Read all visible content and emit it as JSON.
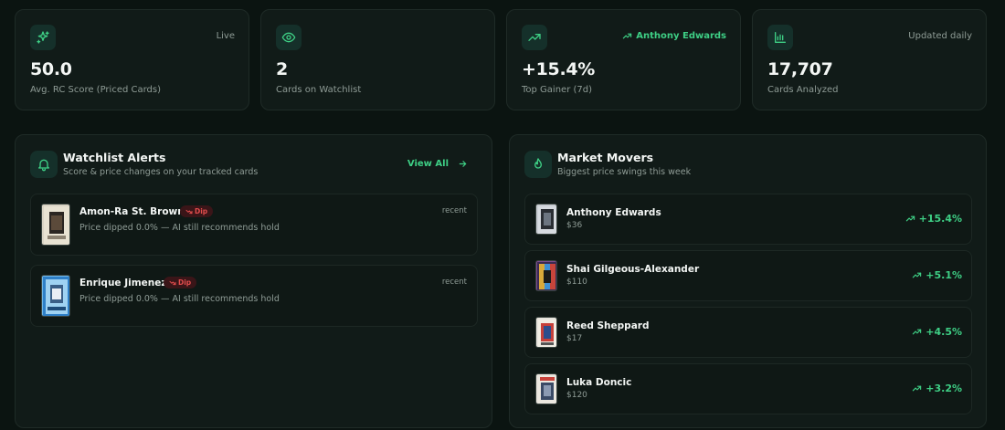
{
  "colors": {
    "accent": "#3ecf85",
    "danger": "#e34d4d",
    "background": "#0b1411",
    "card": "#111b18"
  },
  "stats": [
    {
      "icon": "sparkles-icon",
      "tag": "Live",
      "value": "50.0",
      "label": "Avg. RC Score (Priced Cards)"
    },
    {
      "icon": "eye-icon",
      "tag": "",
      "value": "2",
      "label": "Cards on Watchlist"
    },
    {
      "icon": "trending-up-icon",
      "tag": "Anthony Edwards",
      "value": "+15.4%",
      "label": "Top Gainer (7d)"
    },
    {
      "icon": "bar-chart-icon",
      "tag": "Updated daily",
      "value": "17,707",
      "label": "Cards Analyzed"
    }
  ],
  "watchlist": {
    "icon": "bell-icon",
    "title": "Watchlist Alerts",
    "subtitle": "Score & price changes on your tracked cards",
    "view_all": "View All",
    "alerts": [
      {
        "name": "Amon-Ra St. Brown",
        "badge": "Dip",
        "message": "Price dipped 0.0% — AI still recommends hold",
        "time": "recent"
      },
      {
        "name": "Enrique Jimenez",
        "badge": "Dip",
        "message": "Price dipped 0.0% — AI still recommends hold",
        "time": "recent"
      }
    ]
  },
  "movers": {
    "icon": "flame-icon",
    "title": "Market Movers",
    "subtitle": "Biggest price swings this week",
    "items": [
      {
        "name": "Anthony Edwards",
        "price": "$36",
        "change": "+15.4%"
      },
      {
        "name": "Shai Gilgeous-Alexander",
        "price": "$110",
        "change": "+5.1%"
      },
      {
        "name": "Reed Sheppard",
        "price": "$17",
        "change": "+4.5%"
      },
      {
        "name": "Luka Doncic",
        "price": "$120",
        "change": "+3.2%"
      }
    ]
  }
}
